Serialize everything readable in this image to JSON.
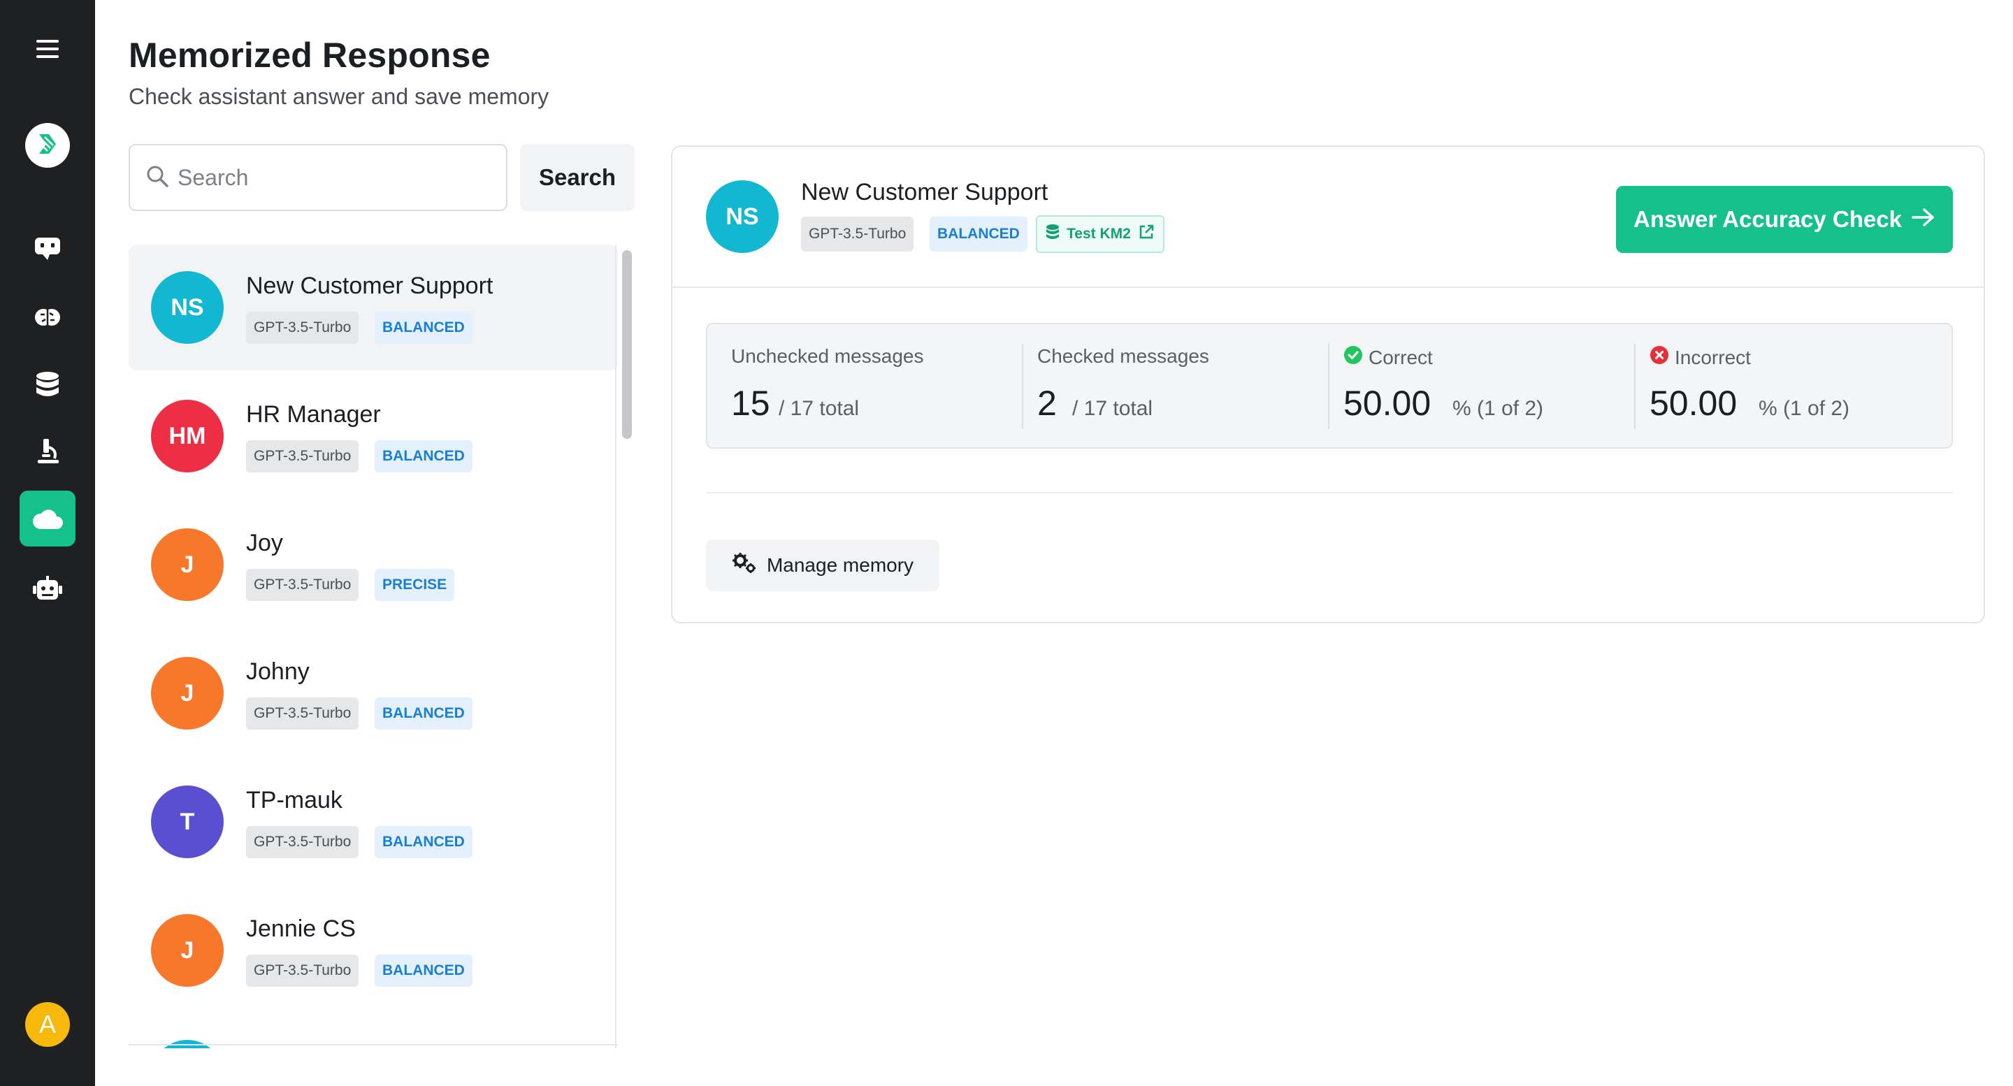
{
  "header": {
    "title": "Memorized Response",
    "subtitle": "Check assistant answer and save memory"
  },
  "search": {
    "placeholder": "Search",
    "button_label": "Search"
  },
  "sidebar": {
    "items": [
      {
        "icon": "menu-icon"
      },
      {
        "icon": "logo-icon"
      },
      {
        "icon": "chat-icon"
      },
      {
        "icon": "brain-icon"
      },
      {
        "icon": "database-icon"
      },
      {
        "icon": "microscope-icon"
      },
      {
        "icon": "cloud-icon",
        "active": true
      },
      {
        "icon": "robot-icon"
      }
    ],
    "user_initial": "A"
  },
  "assistants": [
    {
      "initials": "NS",
      "name": "New Customer Support",
      "model": "GPT-3.5-Turbo",
      "mode": "BALANCED",
      "color": "#12b8d2",
      "selected": true
    },
    {
      "initials": "HM",
      "name": "HR Manager",
      "model": "GPT-3.5-Turbo",
      "mode": "BALANCED",
      "color": "#ee2e45"
    },
    {
      "initials": "J",
      "name": "Joy",
      "model": "GPT-3.5-Turbo",
      "mode": "PRECISE",
      "color": "#f7782b"
    },
    {
      "initials": "J",
      "name": "Johny",
      "model": "GPT-3.5-Turbo",
      "mode": "BALANCED",
      "color": "#f7782b"
    },
    {
      "initials": "T",
      "name": "TP-mauk",
      "model": "GPT-3.5-Turbo",
      "mode": "BALANCED",
      "color": "#5a4fd0"
    },
    {
      "initials": "J",
      "name": "Jennie CS",
      "model": "GPT-3.5-Turbo",
      "mode": "BALANCED",
      "color": "#f7782b"
    }
  ],
  "detail": {
    "initials": "NS",
    "name": "New Customer Support",
    "model": "GPT-3.5-Turbo",
    "mode": "BALANCED",
    "knowledge": "Test KM2",
    "action_label": "Answer Accuracy Check",
    "manage_label": "Manage memory",
    "stats": {
      "unchecked": {
        "label": "Unchecked messages",
        "value": "15",
        "suffix": "/ 17 total"
      },
      "checked": {
        "label": "Checked messages",
        "value": "2",
        "suffix": "/ 17 total"
      },
      "correct": {
        "label": "Correct",
        "value": "50.00",
        "suffix": "% (1 of 2)"
      },
      "incorrect": {
        "label": "Incorrect",
        "value": "50.00",
        "suffix": "% (1 of 2)"
      }
    }
  },
  "colors": {
    "accent": "#16c08a",
    "sidebar_bg": "#1f2022",
    "mode_text": "#1a7fd4",
    "correct": "#22c55e",
    "incorrect": "#e5303a"
  }
}
